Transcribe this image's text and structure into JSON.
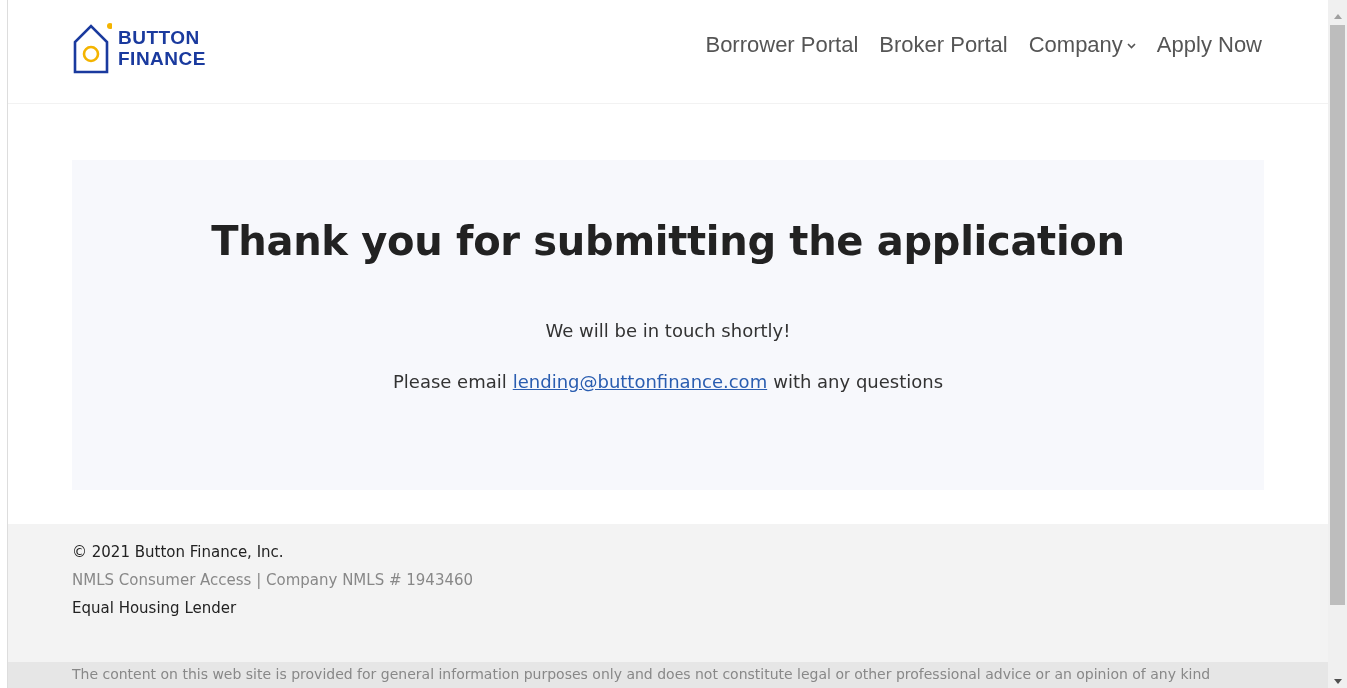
{
  "logo": {
    "lines": [
      "BUTTON",
      "FINANCE"
    ]
  },
  "nav": [
    {
      "label": "Borrower Portal",
      "dropdown": false
    },
    {
      "label": "Broker Portal",
      "dropdown": false
    },
    {
      "label": "Company",
      "dropdown": true
    },
    {
      "label": "Apply Now",
      "dropdown": false
    }
  ],
  "message": {
    "heading": "Thank you for submitting the application",
    "line": "We will be in touch shortly!",
    "email_before": "Please email",
    "email": "lending@buttonfinance.com",
    "email_after": "with any questions"
  },
  "footer": {
    "copyright": "© 2021 Button Finance, Inc.",
    "nmls": "NMLS Consumer Access | Company NMLS # 1943460",
    "housing": "Equal Housing Lender"
  },
  "disclaimer": "The content on this web site is provided for general information purposes only and does not constitute legal or other professional advice or an opinion of any kind"
}
